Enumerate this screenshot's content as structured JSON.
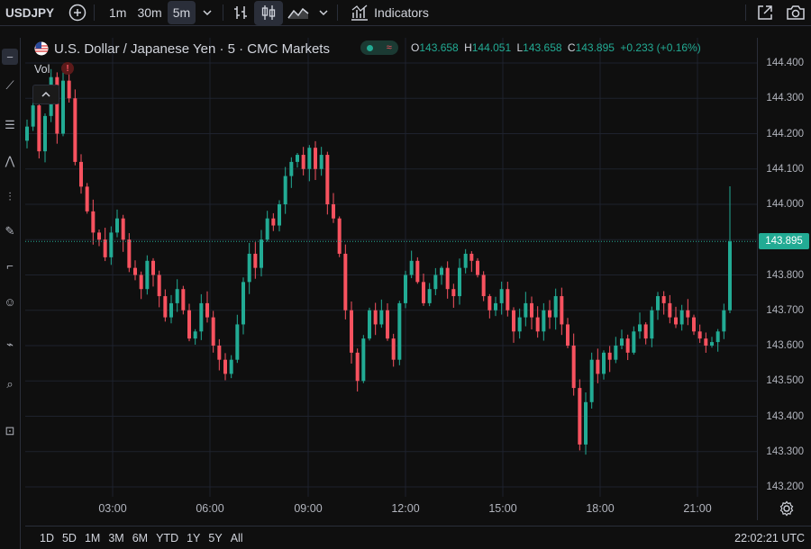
{
  "toolbar": {
    "symbol": "USDJPY",
    "intervals": [
      "1m",
      "30m",
      "5m"
    ],
    "active_interval": "5m",
    "indicators_label": "Indicators"
  },
  "legend": {
    "title": "U.S. Dollar / Japanese Yen · 5 · CMC Markets",
    "open_key": "O",
    "open": "143.658",
    "high_key": "H",
    "high": "144.051",
    "low_key": "L",
    "low": "143.658",
    "close_key": "C",
    "close": "143.895",
    "change": "+0.233 (+0.16%)",
    "vol_label": "Vol",
    "vol_warning": "!"
  },
  "price_axis": {
    "labels": [
      "144.400",
      "144.300",
      "144.200",
      "144.100",
      "144.000",
      "143.900",
      "143.800",
      "143.700",
      "143.600",
      "143.500",
      "143.400",
      "143.300",
      "143.200"
    ],
    "current_price": "143.895"
  },
  "time_axis": {
    "labels": [
      "03:00",
      "06:00",
      "09:00",
      "12:00",
      "15:00",
      "18:00",
      "21:00"
    ]
  },
  "bottom_bar": {
    "ranges": [
      "1D",
      "5D",
      "1M",
      "3M",
      "6M",
      "YTD",
      "1Y",
      "5Y",
      "All"
    ],
    "clock": "22:02:21 UTC"
  },
  "colors": {
    "up": "#22ab94",
    "down": "#f7525f",
    "background": "#0f0f0f",
    "grid": "#1e222d"
  },
  "chart_data": {
    "type": "candlestick",
    "ylim": [
      143.2,
      144.4
    ],
    "xlabels": [
      "03:00",
      "06:00",
      "09:00",
      "12:00",
      "15:00",
      "18:00",
      "21:00"
    ],
    "close_series": [
      144.22,
      144.28,
      144.15,
      144.25,
      144.36,
      144.2,
      144.35,
      144.3,
      144.12,
      144.05,
      143.98,
      143.92,
      143.9,
      143.85,
      143.92,
      143.96,
      143.9,
      143.82,
      143.8,
      143.76,
      143.84,
      143.8,
      143.74,
      143.68,
      143.72,
      143.76,
      143.7,
      143.62,
      143.64,
      143.72,
      143.68,
      143.6,
      143.56,
      143.52,
      143.56,
      143.66,
      143.78,
      143.86,
      143.82,
      143.9,
      143.96,
      143.94,
      144.0,
      144.08,
      144.12,
      144.14,
      144.1,
      144.16,
      144.1,
      144.14,
      144.0,
      143.96,
      143.86,
      143.7,
      143.58,
      143.5,
      143.62,
      143.7,
      143.66,
      143.7,
      143.62,
      143.56,
      143.72,
      143.8,
      143.84,
      143.78,
      143.72,
      143.76,
      143.8,
      143.82,
      143.76,
      143.74,
      143.82,
      143.86,
      143.84,
      143.8,
      143.74,
      143.7,
      143.72,
      143.76,
      143.7,
      143.64,
      143.68,
      143.72,
      143.68,
      143.64,
      143.7,
      143.68,
      143.74,
      143.66,
      143.6,
      143.48,
      143.32,
      143.44,
      143.56,
      143.52,
      143.58,
      143.56,
      143.6,
      143.62,
      143.58,
      143.64,
      143.66,
      143.62,
      143.7,
      143.74,
      143.72,
      143.68,
      143.66,
      143.7,
      143.68,
      143.64,
      143.62,
      143.6,
      143.61,
      143.64,
      143.7,
      143.895
    ]
  }
}
